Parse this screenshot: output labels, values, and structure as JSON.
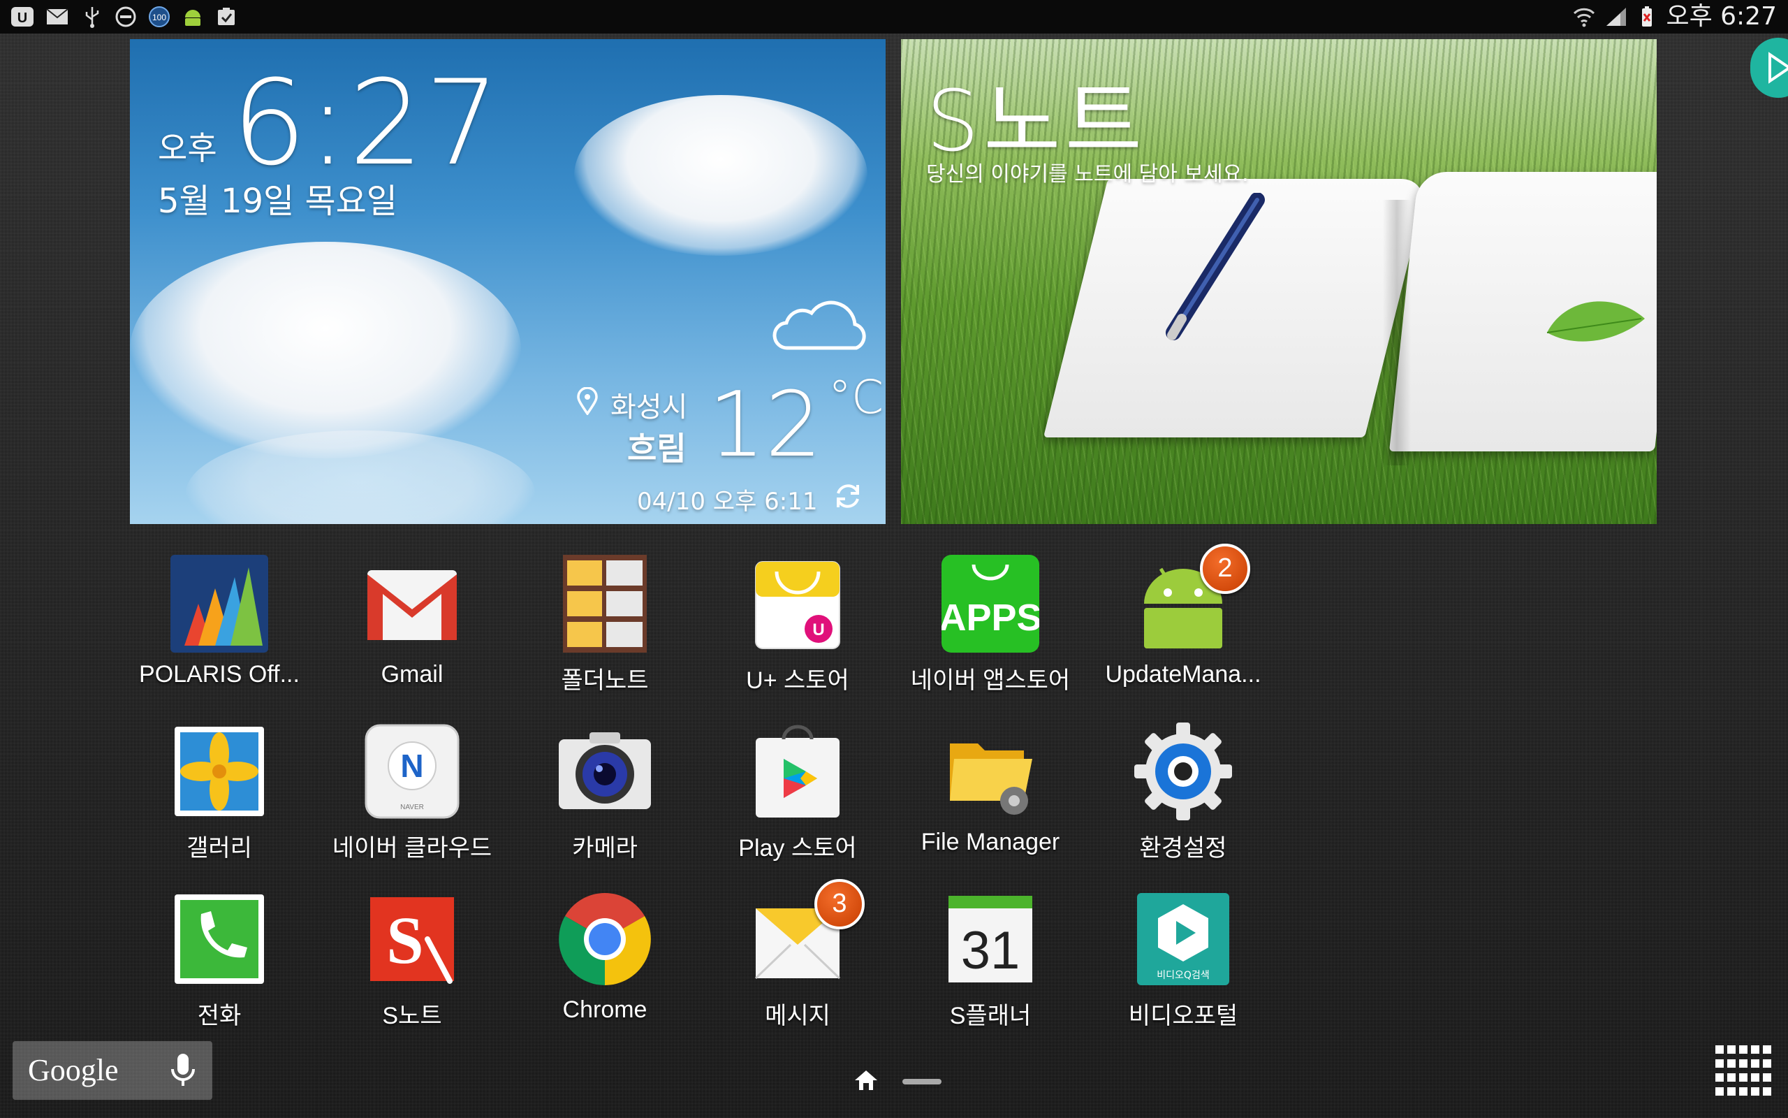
{
  "status_bar": {
    "left_icons": [
      "uplus-icon",
      "mail-icon",
      "usb-icon",
      "do-not-disturb-icon",
      "battery-100-icon",
      "android-icon",
      "clipboard-icon"
    ],
    "battery_badge": "100",
    "time": "오후 6:27"
  },
  "clock_widget": {
    "ampm": "오후",
    "time": "6:27",
    "date": "5월 19일 목요일",
    "location": "화성시",
    "condition": "흐림",
    "temperature": "12",
    "unit": "°C",
    "updated": "04/10 오후 6:11"
  },
  "snote_widget": {
    "title": "S노트",
    "subtitle": "당신의 이야기를 노트에 담아 보세요."
  },
  "apps": [
    {
      "label": "POLARIS Off...",
      "icon": "polaris-office-icon",
      "badge": ""
    },
    {
      "label": "Gmail",
      "icon": "gmail-icon",
      "badge": ""
    },
    {
      "label": "폴더노트",
      "icon": "folder-note-icon",
      "badge": ""
    },
    {
      "label": "U+ 스토어",
      "icon": "uplus-store-icon",
      "badge": ""
    },
    {
      "label": "네이버 앱스토어",
      "icon": "naver-appstore-icon",
      "badge": ""
    },
    {
      "label": "UpdateMana...",
      "icon": "android-update-icon",
      "badge": "2"
    },
    {
      "label": "갤러리",
      "icon": "gallery-icon",
      "badge": ""
    },
    {
      "label": "네이버 클라우드",
      "icon": "naver-cloud-icon",
      "badge": ""
    },
    {
      "label": "카메라",
      "icon": "camera-icon",
      "badge": ""
    },
    {
      "label": "Play 스토어",
      "icon": "play-store-icon",
      "badge": ""
    },
    {
      "label": "File Manager",
      "icon": "file-manager-icon",
      "badge": ""
    },
    {
      "label": "환경설정",
      "icon": "settings-icon",
      "badge": ""
    },
    {
      "label": "전화",
      "icon": "phone-icon",
      "badge": ""
    },
    {
      "label": "S노트",
      "icon": "snote-icon",
      "badge": ""
    },
    {
      "label": "Chrome",
      "icon": "chrome-icon",
      "badge": ""
    },
    {
      "label": "메시지",
      "icon": "messages-icon",
      "badge": "3"
    },
    {
      "label": "S플래너",
      "icon": "splanner-icon",
      "badge": ""
    },
    {
      "label": "비디오포털",
      "icon": "video-portal-icon",
      "badge": ""
    }
  ],
  "icon_text": {
    "naver_appstore": "APPS",
    "naver_cloud_letter": "N",
    "naver_cloud_small": "NAVER",
    "snote_letter": "S",
    "splanner_day": "31",
    "video_portal_small": "비디오Q검색"
  },
  "google_bar": {
    "label": "Google"
  },
  "colors": {
    "accent_teal": "#1fb5a0",
    "badge_orange": "#e2550f"
  }
}
